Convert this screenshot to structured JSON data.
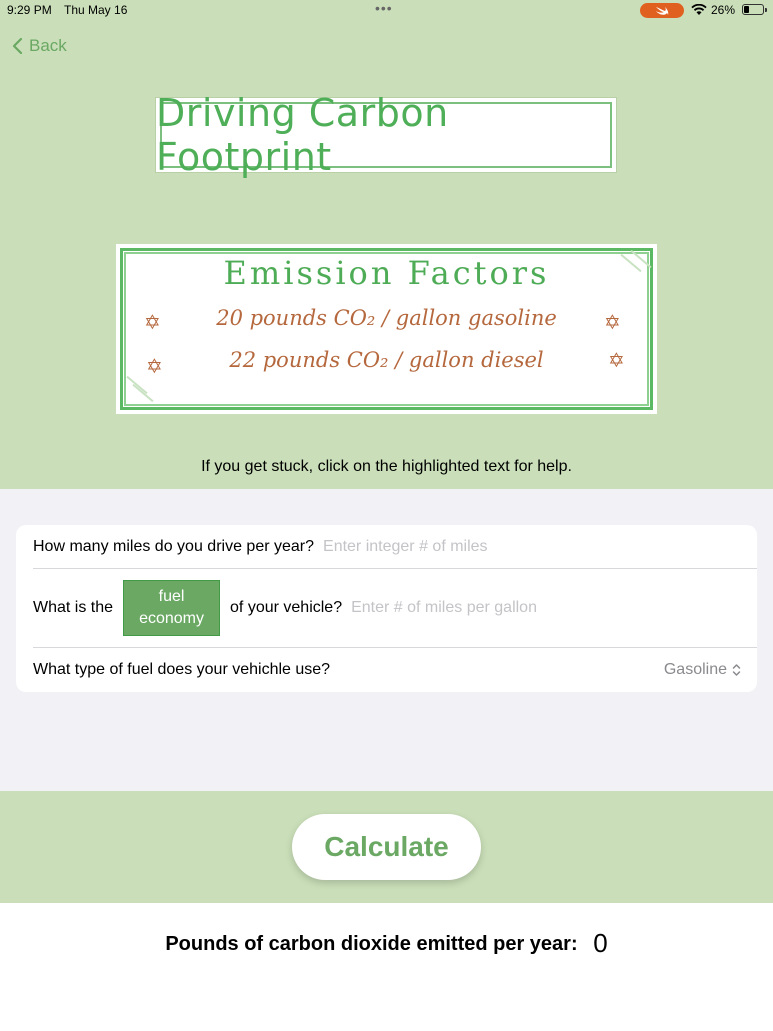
{
  "status_bar": {
    "time": "9:29 PM",
    "date": "Thu May 16",
    "battery": "26%",
    "icons": [
      "swift-icon",
      "wifi-icon",
      "battery-icon"
    ]
  },
  "nav": {
    "back_label": "Back"
  },
  "header": {
    "title": "Driving Carbon Footprint"
  },
  "emission_card": {
    "title": "Emission Factors",
    "factors": [
      "20 pounds CO₂ / gallon gasoline",
      "22 pounds CO₂ / gallon diesel"
    ]
  },
  "help_text": "If you get stuck, click on the highlighted text for help.",
  "form": {
    "miles_label": "How many miles do you drive per year?",
    "miles_placeholder": "Enter integer # of miles",
    "fuel_prefix": "What is the",
    "fuel_button": "fuel economy",
    "fuel_suffix": "of your vehicle?",
    "fuel_placeholder": "Enter # of miles per gallon",
    "type_label": "What type of fuel does your vehichle use?",
    "type_value": "Gasoline"
  },
  "calculate_label": "Calculate",
  "result": {
    "label": "Pounds of carbon dioxide emitted per year:",
    "value": "0"
  },
  "colors": {
    "green_bg": "#cadfb9",
    "accent_green": "#6aa863",
    "factor_brown": "#b5683d",
    "form_bg": "#f2f2f6"
  }
}
